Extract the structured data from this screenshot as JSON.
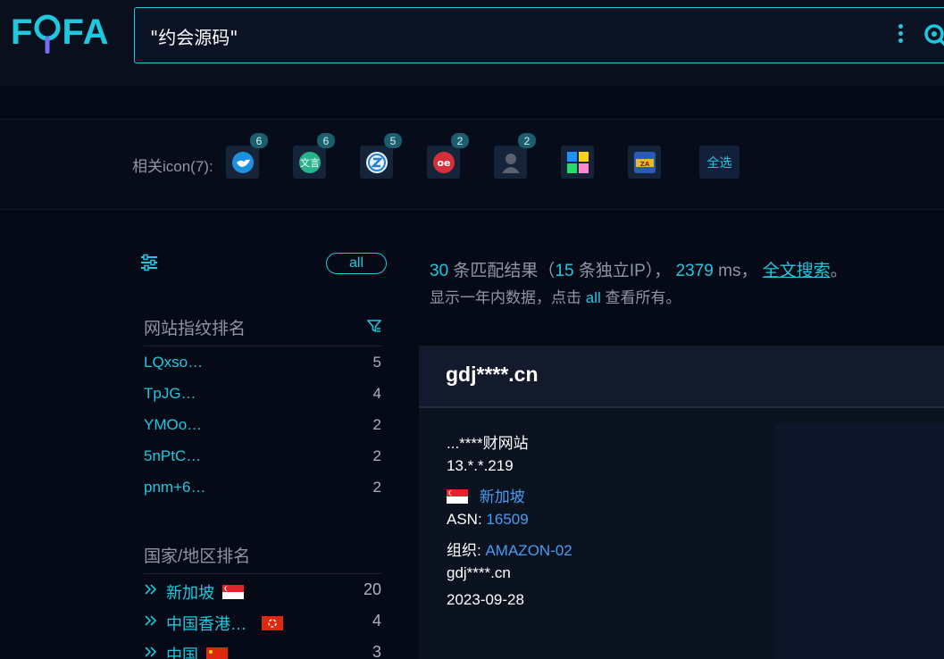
{
  "header": {
    "logo_text": "FOFA",
    "search_value": "\"约会源码\"",
    "accent": "#1ec9e0"
  },
  "icon_row": {
    "label": "相关icon(7):",
    "icons": [
      {
        "name": "bird-icon",
        "badge": "6"
      },
      {
        "name": "chat-icon",
        "badge": "6"
      },
      {
        "name": "z-logo-icon",
        "badge": "5"
      },
      {
        "name": "oe-logo-icon",
        "badge": "2"
      },
      {
        "name": "person-icon",
        "badge": "2"
      },
      {
        "name": "tiles-icon",
        "badge": ""
      },
      {
        "name": "app-logo-icon",
        "badge": ""
      }
    ],
    "select_all": "全选"
  },
  "sidebar": {
    "all_label": "all",
    "fingerprint_title": "网站指纹排名",
    "fingerprints": [
      {
        "name": "LQxso…",
        "count": "5"
      },
      {
        "name": "TpJG…",
        "count": "4"
      },
      {
        "name": "YMOo…",
        "count": "2"
      },
      {
        "name": "5nPtC…",
        "count": "2"
      },
      {
        "name": "pnm+6…",
        "count": "2"
      }
    ],
    "country_title": "国家/地区排名",
    "countries": [
      {
        "name": "新加坡",
        "count": "20",
        "flag": "singapore"
      },
      {
        "name": "中国香港…",
        "count": "4",
        "flag": "hong-kong"
      },
      {
        "name": "中国",
        "count": "3",
        "flag": "china"
      }
    ]
  },
  "summary": {
    "count": "30",
    "count_suffix": "条匹配结果（",
    "ips": "15",
    "ips_suffix": "条独立IP），",
    "ms": "2379",
    "ms_suffix": "ms，",
    "fulltext": "全文搜索",
    "end": "。",
    "line2_prefix": "显示一年内数据，点击",
    "line2_all": "all",
    "line2_suffix": "查看所有。"
  },
  "result": {
    "host": "gdj****.cn",
    "title": "...****财网站",
    "ip": "13.*.*.219",
    "country": "新加坡",
    "asn_label": "ASN:",
    "asn": "16509",
    "org_label": "组织:",
    "org": "AMAZON-02",
    "domain": "gdj****.cn",
    "date": "2023-09-28"
  }
}
